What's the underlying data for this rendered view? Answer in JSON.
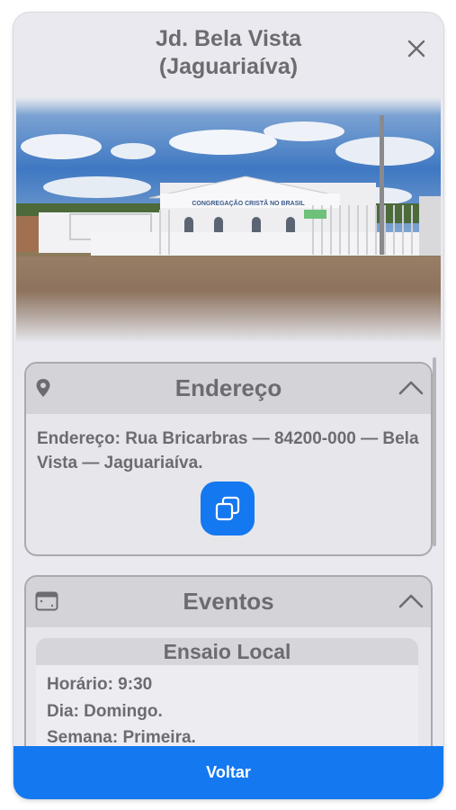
{
  "header": {
    "title": "Jd. Bela Vista\n(Jaguariaíva)"
  },
  "photo": {
    "sign_text": "CONGREGAÇÃO CRISTÃ NO BRASIL"
  },
  "address_card": {
    "title": "Endereço",
    "text": "Endereço: Rua Bricarbras — 84200-000 — Bela Vista — Jaguariaíva.",
    "icon": "map-pin-icon",
    "copy_icon": "copy-icon"
  },
  "events_card": {
    "title": "Eventos",
    "icon": "calendar-icon",
    "event": {
      "title": "Ensaio Local",
      "time": "Horário: 9:30",
      "day": "Dia: Domingo.",
      "week": "Semana: Primeira."
    }
  },
  "footer": {
    "button_label": "Voltar"
  },
  "colors": {
    "accent": "#1478f0",
    "text_gray": "#6c6c70",
    "panel": "#e9e9ef"
  }
}
